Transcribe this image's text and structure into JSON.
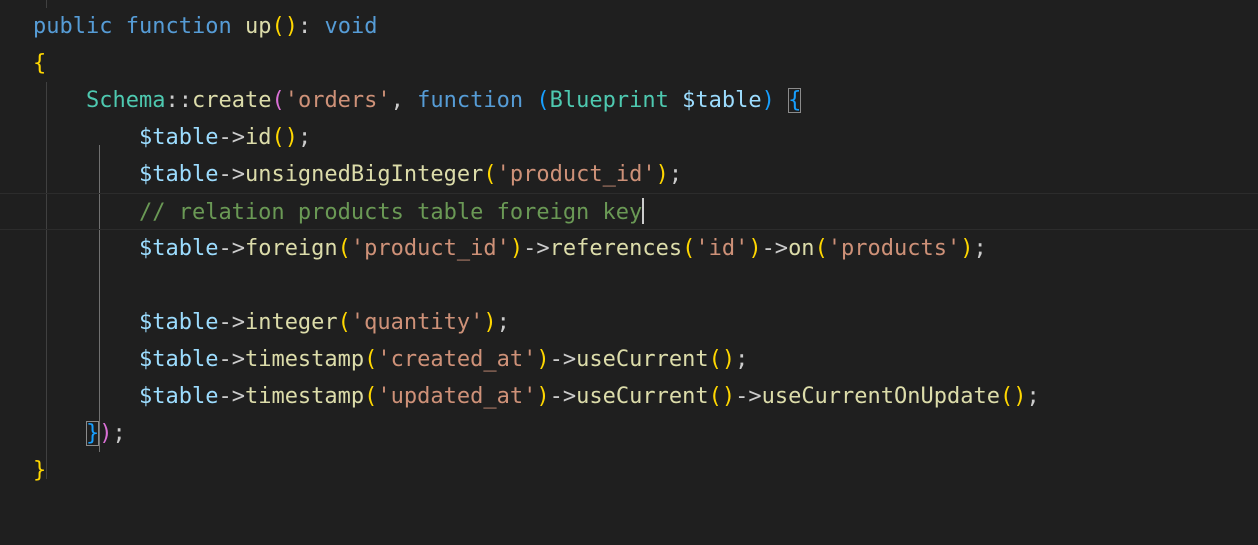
{
  "editor": {
    "colors": {
      "background": "#1f1f1f",
      "keyword": "#569cd6",
      "function": "#dcdcaa",
      "class": "#4ec9b0",
      "variable": "#9cdcfe",
      "string": "#ce9178",
      "comment": "#6a9955",
      "bracket_level_1": "#ffd700",
      "bracket_level_2": "#da70d6",
      "bracket_level_3": "#179fff"
    },
    "lines": [
      {
        "name": "code-line-1",
        "tokens": [
          {
            "t": "public",
            "c": "kw"
          },
          {
            "t": " "
          },
          {
            "t": "function",
            "c": "kw"
          },
          {
            "t": " "
          },
          {
            "t": "up",
            "c": "fn"
          },
          {
            "t": "(",
            "c": "b1"
          },
          {
            "t": ")",
            "c": "b1"
          },
          {
            "t": ": "
          },
          {
            "t": "void",
            "c": "kw"
          }
        ]
      },
      {
        "name": "code-line-2",
        "tokens": [
          {
            "t": "{",
            "c": "b1"
          }
        ]
      },
      {
        "name": "code-line-3",
        "tokens": [
          {
            "t": "    "
          },
          {
            "t": "Schema",
            "c": "cls"
          },
          {
            "t": "::"
          },
          {
            "t": "create",
            "c": "fn"
          },
          {
            "t": "(",
            "c": "b2"
          },
          {
            "t": "'orders'",
            "c": "str"
          },
          {
            "t": ", "
          },
          {
            "t": "function",
            "c": "kw"
          },
          {
            "t": " "
          },
          {
            "t": "(",
            "c": "b3"
          },
          {
            "t": "Blueprint",
            "c": "cls"
          },
          {
            "t": " "
          },
          {
            "t": "$table",
            "c": "var"
          },
          {
            "t": ")",
            "c": "b3"
          },
          {
            "t": " "
          },
          {
            "t": "{",
            "c": "b3 bm"
          }
        ]
      },
      {
        "name": "code-line-4",
        "tokens": [
          {
            "t": "        "
          },
          {
            "t": "$table",
            "c": "var"
          },
          {
            "t": "->"
          },
          {
            "t": "id",
            "c": "fn"
          },
          {
            "t": "(",
            "c": "b1"
          },
          {
            "t": ")",
            "c": "b1"
          },
          {
            "t": ";"
          }
        ]
      },
      {
        "name": "code-line-5",
        "tokens": [
          {
            "t": "        "
          },
          {
            "t": "$table",
            "c": "var"
          },
          {
            "t": "->"
          },
          {
            "t": "unsignedBigInteger",
            "c": "fn"
          },
          {
            "t": "(",
            "c": "b1"
          },
          {
            "t": "'product_id'",
            "c": "str"
          },
          {
            "t": ")",
            "c": "b1"
          },
          {
            "t": ";"
          }
        ]
      },
      {
        "name": "code-line-6",
        "current": true,
        "tokens": [
          {
            "t": "        "
          },
          {
            "t": "// relation products table foreign key",
            "c": "cmt"
          }
        ]
      },
      {
        "name": "code-line-7",
        "tokens": [
          {
            "t": "        "
          },
          {
            "t": "$table",
            "c": "var"
          },
          {
            "t": "->"
          },
          {
            "t": "foreign",
            "c": "fn"
          },
          {
            "t": "(",
            "c": "b1"
          },
          {
            "t": "'product_id'",
            "c": "str"
          },
          {
            "t": ")",
            "c": "b1"
          },
          {
            "t": "->"
          },
          {
            "t": "references",
            "c": "fn"
          },
          {
            "t": "(",
            "c": "b1"
          },
          {
            "t": "'id'",
            "c": "str"
          },
          {
            "t": ")",
            "c": "b1"
          },
          {
            "t": "->"
          },
          {
            "t": "on",
            "c": "fn"
          },
          {
            "t": "(",
            "c": "b1"
          },
          {
            "t": "'products'",
            "c": "str"
          },
          {
            "t": ")",
            "c": "b1"
          },
          {
            "t": ";"
          }
        ]
      },
      {
        "name": "code-line-8",
        "tokens": []
      },
      {
        "name": "code-line-9",
        "tokens": [
          {
            "t": "        "
          },
          {
            "t": "$table",
            "c": "var"
          },
          {
            "t": "->"
          },
          {
            "t": "integer",
            "c": "fn"
          },
          {
            "t": "(",
            "c": "b1"
          },
          {
            "t": "'quantity'",
            "c": "str"
          },
          {
            "t": ")",
            "c": "b1"
          },
          {
            "t": ";"
          }
        ]
      },
      {
        "name": "code-line-10",
        "tokens": [
          {
            "t": "        "
          },
          {
            "t": "$table",
            "c": "var"
          },
          {
            "t": "->"
          },
          {
            "t": "timestamp",
            "c": "fn"
          },
          {
            "t": "(",
            "c": "b1"
          },
          {
            "t": "'created_at'",
            "c": "str"
          },
          {
            "t": ")",
            "c": "b1"
          },
          {
            "t": "->"
          },
          {
            "t": "useCurrent",
            "c": "fn"
          },
          {
            "t": "(",
            "c": "b1"
          },
          {
            "t": ")",
            "c": "b1"
          },
          {
            "t": ";"
          }
        ]
      },
      {
        "name": "code-line-11",
        "tokens": [
          {
            "t": "        "
          },
          {
            "t": "$table",
            "c": "var"
          },
          {
            "t": "->"
          },
          {
            "t": "timestamp",
            "c": "fn"
          },
          {
            "t": "(",
            "c": "b1"
          },
          {
            "t": "'updated_at'",
            "c": "str"
          },
          {
            "t": ")",
            "c": "b1"
          },
          {
            "t": "->"
          },
          {
            "t": "useCurrent",
            "c": "fn"
          },
          {
            "t": "(",
            "c": "b1"
          },
          {
            "t": ")",
            "c": "b1"
          },
          {
            "t": "->"
          },
          {
            "t": "useCurrentOnUpdate",
            "c": "fn"
          },
          {
            "t": "(",
            "c": "b1"
          },
          {
            "t": ")",
            "c": "b1"
          },
          {
            "t": ";"
          }
        ]
      },
      {
        "name": "code-line-12",
        "tokens": [
          {
            "t": "    "
          },
          {
            "t": "}",
            "c": "b3 bm"
          },
          {
            "t": ")",
            "c": "b2"
          },
          {
            "t": ";"
          }
        ]
      },
      {
        "name": "code-line-13",
        "tokens": [
          {
            "t": "}",
            "c": "b1"
          }
        ]
      }
    ]
  }
}
